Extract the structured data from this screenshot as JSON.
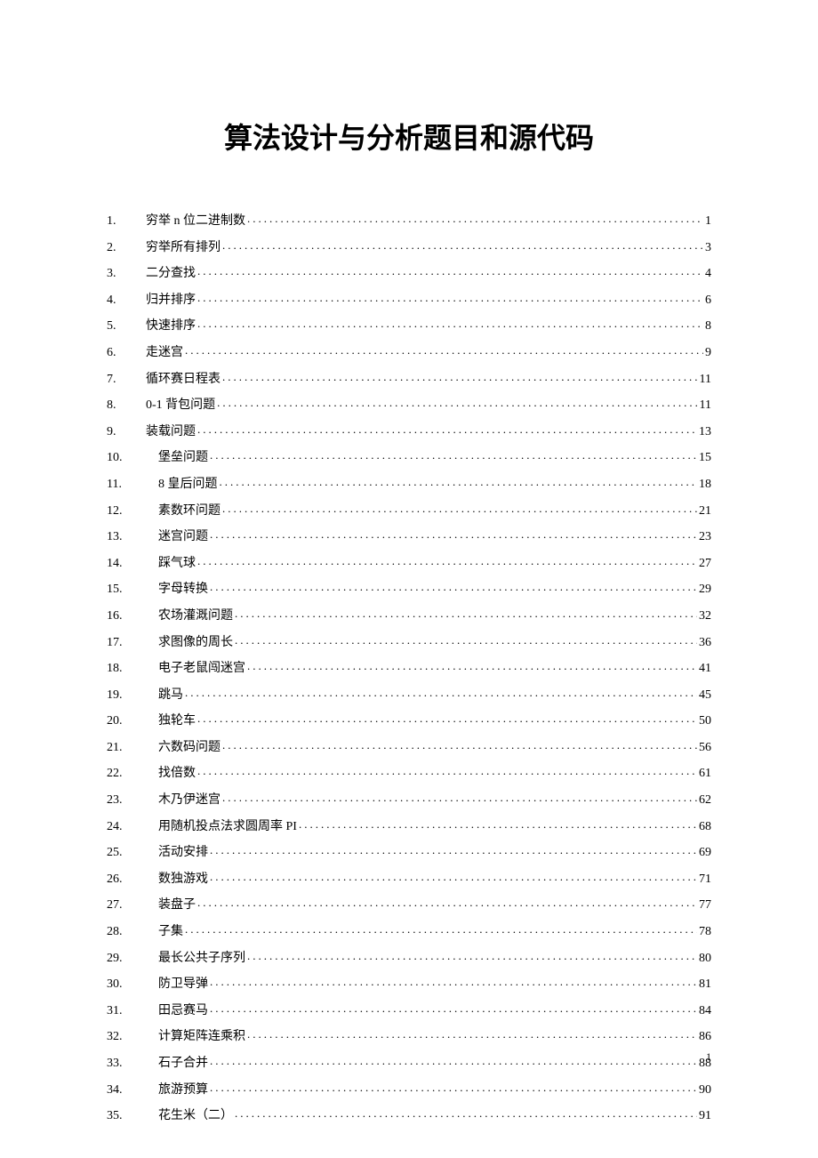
{
  "title": "算法设计与分析题目和源代码",
  "page_number": "1",
  "toc": [
    {
      "num": "1.",
      "label": "穷举 n 位二进制数",
      "page": "1",
      "indent": false
    },
    {
      "num": "2.",
      "label": "穷举所有排列",
      "page": "3",
      "indent": false
    },
    {
      "num": "3.",
      "label": "二分查找",
      "page": "4",
      "indent": false
    },
    {
      "num": "4.",
      "label": "归并排序",
      "page": "6",
      "indent": false
    },
    {
      "num": "5.",
      "label": "快速排序",
      "page": "8",
      "indent": false
    },
    {
      "num": "6.",
      "label": "走迷宫",
      "page": "9",
      "indent": false
    },
    {
      "num": "7.",
      "label": "循环赛日程表",
      "page": "11",
      "indent": false
    },
    {
      "num": "8.",
      "label": "0-1 背包问题 ",
      "page": "11",
      "indent": false
    },
    {
      "num": "9.",
      "label": "装载问题",
      "page": "13",
      "indent": false
    },
    {
      "num": "10.",
      "label": "堡垒问题",
      "page": "15",
      "indent": true
    },
    {
      "num": "11.",
      "label": "8 皇后问题",
      "page": "18",
      "indent": true
    },
    {
      "num": "12.",
      "label": "素数环问题",
      "page": "21",
      "indent": true
    },
    {
      "num": "13.",
      "label": "迷宫问题",
      "page": "23",
      "indent": true
    },
    {
      "num": "14.",
      "label": "踩气球",
      "page": "27",
      "indent": true
    },
    {
      "num": "15.",
      "label": "字母转换",
      "page": "29",
      "indent": true
    },
    {
      "num": "16.",
      "label": "农场灌溉问题",
      "page": "32",
      "indent": true
    },
    {
      "num": "17.",
      "label": "求图像的周长",
      "page": "36",
      "indent": true
    },
    {
      "num": "18.",
      "label": "电子老鼠闯迷宫",
      "page": "41",
      "indent": true
    },
    {
      "num": "19.",
      "label": "跳马",
      "page": "45",
      "indent": true
    },
    {
      "num": "20.",
      "label": "独轮车",
      "page": "50",
      "indent": true
    },
    {
      "num": "21.",
      "label": "六数码问题",
      "page": "56",
      "indent": true
    },
    {
      "num": "22.",
      "label": "找倍数",
      "page": "61",
      "indent": true
    },
    {
      "num": "23.",
      "label": "木乃伊迷宫",
      "page": "62",
      "indent": true
    },
    {
      "num": "24.",
      "label": "用随机投点法求圆周率 PI",
      "page": "68",
      "indent": true
    },
    {
      "num": "25.",
      "label": "活动安排",
      "page": "69",
      "indent": true
    },
    {
      "num": "26.",
      "label": "数独游戏",
      "page": "71",
      "indent": true
    },
    {
      "num": "27.",
      "label": "装盘子",
      "page": "77",
      "indent": true
    },
    {
      "num": "28.",
      "label": "子集",
      "page": "78",
      "indent": true
    },
    {
      "num": "29.",
      "label": "最长公共子序列",
      "page": "80",
      "indent": true
    },
    {
      "num": "30.",
      "label": "防卫导弹",
      "page": "81",
      "indent": true
    },
    {
      "num": "31.",
      "label": "田忌赛马",
      "page": "84",
      "indent": true
    },
    {
      "num": "32.",
      "label": "计算矩阵连乘积",
      "page": "86",
      "indent": true
    },
    {
      "num": "33.",
      "label": "石子合并",
      "page": "88",
      "indent": true
    },
    {
      "num": "34.",
      "label": "旅游预算",
      "page": "90",
      "indent": true
    },
    {
      "num": "35.",
      "label": "花生米（二）",
      "page": "91",
      "indent": true
    }
  ]
}
